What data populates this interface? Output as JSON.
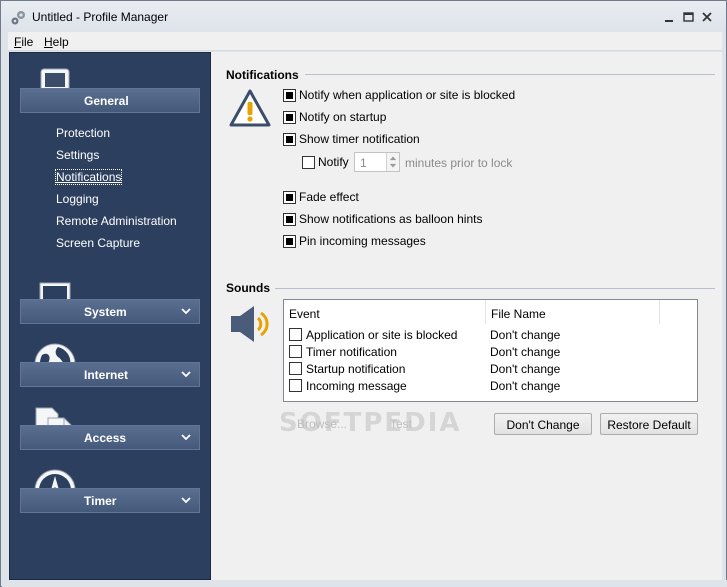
{
  "window": {
    "title": "Untitled - Profile Manager",
    "menu": [
      {
        "label": "File",
        "accel": "F",
        "rest": "ile"
      },
      {
        "label": "Help",
        "accel": "H",
        "rest": "elp"
      }
    ]
  },
  "sidebar": {
    "sections": [
      {
        "label": "General",
        "icon": "ipod-icon",
        "expanded": true,
        "items": [
          "Protection",
          "Settings",
          "Notifications",
          "Logging",
          "Remote Administration",
          "Screen Capture"
        ],
        "selected": "Notifications"
      },
      {
        "label": "System",
        "icon": "computer-icon",
        "expanded": false
      },
      {
        "label": "Internet",
        "icon": "globe-icon",
        "expanded": false
      },
      {
        "label": "Access",
        "icon": "documents-icon",
        "expanded": false
      },
      {
        "label": "Timer",
        "icon": "compass-icon",
        "expanded": false
      }
    ]
  },
  "notifications": {
    "title": "Notifications",
    "icon": "warning-icon",
    "options": [
      {
        "label": "Notify when application or site is blocked",
        "checked": true
      },
      {
        "label": "Notify on startup",
        "checked": true
      },
      {
        "label": "Show timer notification",
        "checked": true
      }
    ],
    "timer": {
      "notify_label": "Notify",
      "notify_checked": false,
      "minutes_value": "1",
      "suffix": "minutes prior to lock"
    },
    "options2": [
      {
        "label": "Fade effect",
        "checked": true
      },
      {
        "label": "Show notifications as balloon hints",
        "checked": true
      },
      {
        "label": "Pin incoming messages",
        "checked": true
      }
    ]
  },
  "sounds": {
    "title": "Sounds",
    "icon": "speaker-icon",
    "columns": [
      "Event",
      "File Name"
    ],
    "rows": [
      {
        "event": "Application or site is blocked",
        "file": "Don't change",
        "checked": false
      },
      {
        "event": "Timer notification",
        "file": "Don't change",
        "checked": false
      },
      {
        "event": "Startup notification",
        "file": "Don't change",
        "checked": false
      },
      {
        "event": "Incoming message",
        "file": "Don't change",
        "checked": false
      }
    ],
    "buttons": {
      "browse": "Browse...",
      "test": "Test",
      "dont_change": "Don't Change",
      "restore_default": "Restore Default"
    }
  },
  "watermark": "SOFTPEDIA"
}
